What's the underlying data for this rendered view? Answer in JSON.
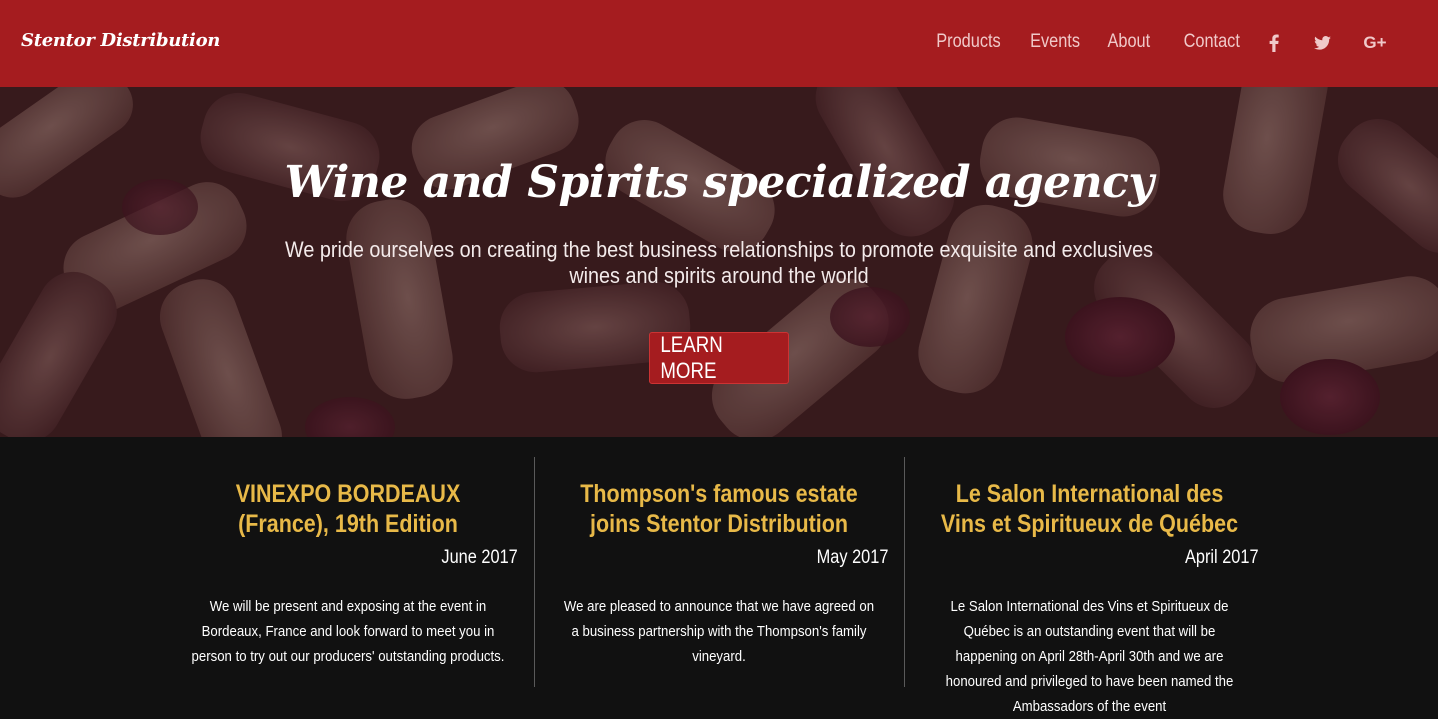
{
  "brand": {
    "name": "Stentor Distribution"
  },
  "nav": {
    "items": [
      {
        "label": "Products"
      },
      {
        "label": "Events"
      },
      {
        "label": "About"
      },
      {
        "label": "Contact"
      }
    ],
    "social": [
      {
        "icon": "facebook-icon",
        "glyph": "f"
      },
      {
        "icon": "twitter-icon",
        "glyph": "twitter"
      },
      {
        "icon": "google-plus-icon",
        "glyph": "G+"
      }
    ]
  },
  "hero": {
    "title": "Wine and Spirits specialized agency",
    "subtitle": "We pride ourselves on creating the best business relationships to promote exquisite and exclusives wines and spirits around the world",
    "button": "LEARN MORE"
  },
  "news": [
    {
      "title": "VINEXPO BORDEAUX (France), 19th Edition",
      "date": "June 2017",
      "text": "We will be present and exposing at the event in Bordeaux, France and look forward to meet you in person to try out our producers' outstanding products."
    },
    {
      "title": "Thompson's famous estate joins Stentor Distribution",
      "date": "May 2017",
      "text": "We are pleased to announce that we have agreed on a business partnership with the Thompson's family vineyard."
    },
    {
      "title": "Le Salon International des Vins et Spiritueux de Québec",
      "date": "April 2017",
      "text": "Le Salon International des Vins et Spiritueux de Québec is an outstanding event that will be happening on April 28th-April 30th and we are honoured and privileged to have been named the Ambassadors of the event"
    }
  ],
  "colors": {
    "navbar": "#a51c1f",
    "accent_gold": "#e8b948",
    "background": "#111111"
  }
}
